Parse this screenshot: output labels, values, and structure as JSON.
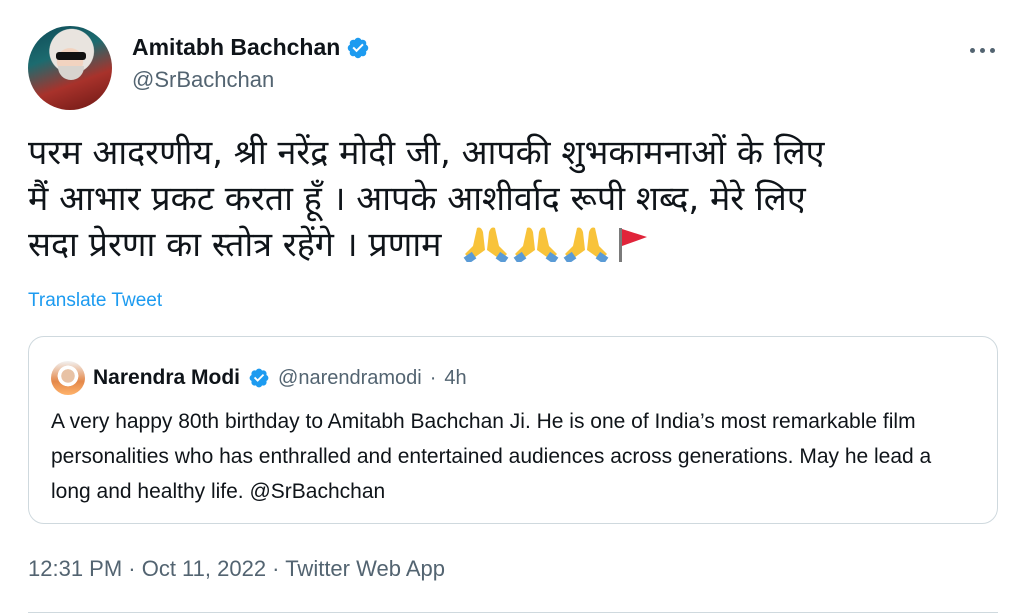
{
  "author": {
    "display_name": "Amitabh Bachchan",
    "handle": "@SrBachchan",
    "verified": true
  },
  "tweet": {
    "text": "परम आदरणीय, श्री नरेंद्र मोदी जी, आपकी शुभकामनाओं के लिए\nमैं आभार प्रकट करता हूँ  । आपके आशीर्वाद रूपी शब्द, मेरे लिए\nसदा प्रेरणा का स्तोत्र रहेंगे  । प्रणाम",
    "emojis": [
      "folded-hands",
      "folded-hands",
      "folded-hands",
      "triangular-flag"
    ],
    "translate_label": "Translate Tweet"
  },
  "quoted_tweet": {
    "display_name": "Narendra Modi",
    "handle": "@narendramodi",
    "separator": "·",
    "age": "4h",
    "verified": true,
    "text": "A very happy 80th birthday to Amitabh Bachchan Ji. He is one of India’s most remarkable film personalities who has enthralled and entertained audiences across generations. May he lead a long and healthy life. @SrBachchan"
  },
  "footer": {
    "timestamp": "12:31 PM · Oct 11, 2022 · Twitter Web App"
  },
  "colors": {
    "accent": "#1d9bf0",
    "text": "#0f1419",
    "secondary": "#536471",
    "border": "#cfd9de"
  }
}
